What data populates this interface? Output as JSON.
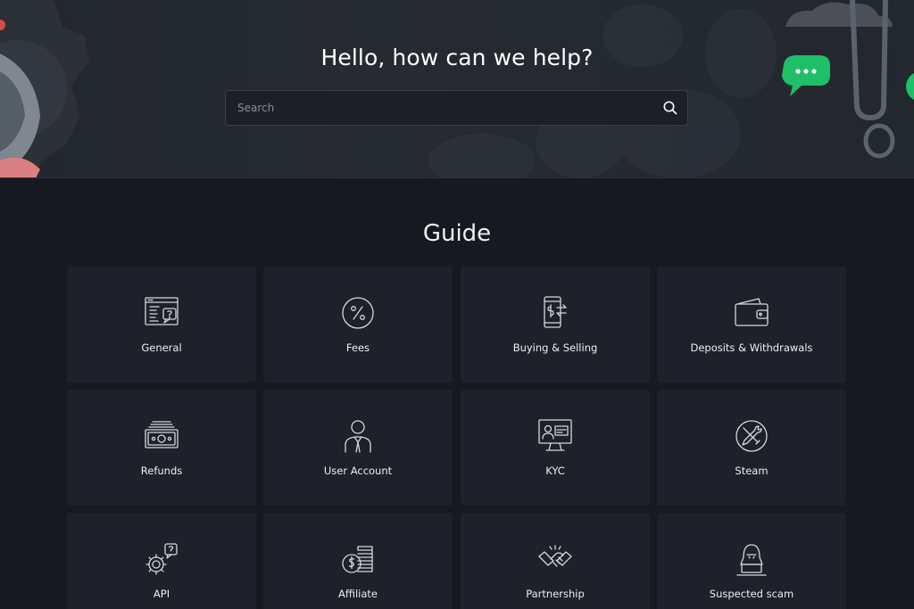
{
  "hero": {
    "title": "Hello, how can we help?",
    "search_placeholder": "Search"
  },
  "guide": {
    "title": "Guide",
    "cards": [
      {
        "label": "General",
        "icon": "browser-help-icon"
      },
      {
        "label": "Fees",
        "icon": "percent-icon"
      },
      {
        "label": "Buying & Selling",
        "icon": "phone-exchange-icon"
      },
      {
        "label": "Deposits & Withdrawals",
        "icon": "wallet-icon"
      },
      {
        "label": "Refunds",
        "icon": "cash-stack-icon"
      },
      {
        "label": "User Account",
        "icon": "user-icon"
      },
      {
        "label": "KYC",
        "icon": "id-monitor-icon"
      },
      {
        "label": "Steam",
        "icon": "tools-icon"
      },
      {
        "label": "API",
        "icon": "gear-question-icon"
      },
      {
        "label": "Affiliate",
        "icon": "coins-icon"
      },
      {
        "label": "Partnership",
        "icon": "handshake-icon"
      },
      {
        "label": "Suspected scam",
        "icon": "hacker-icon"
      }
    ]
  },
  "colors": {
    "background": "#161920",
    "card": "#1e2129",
    "accent_green": "#1fbf67",
    "accent_red": "#f06a6a"
  }
}
